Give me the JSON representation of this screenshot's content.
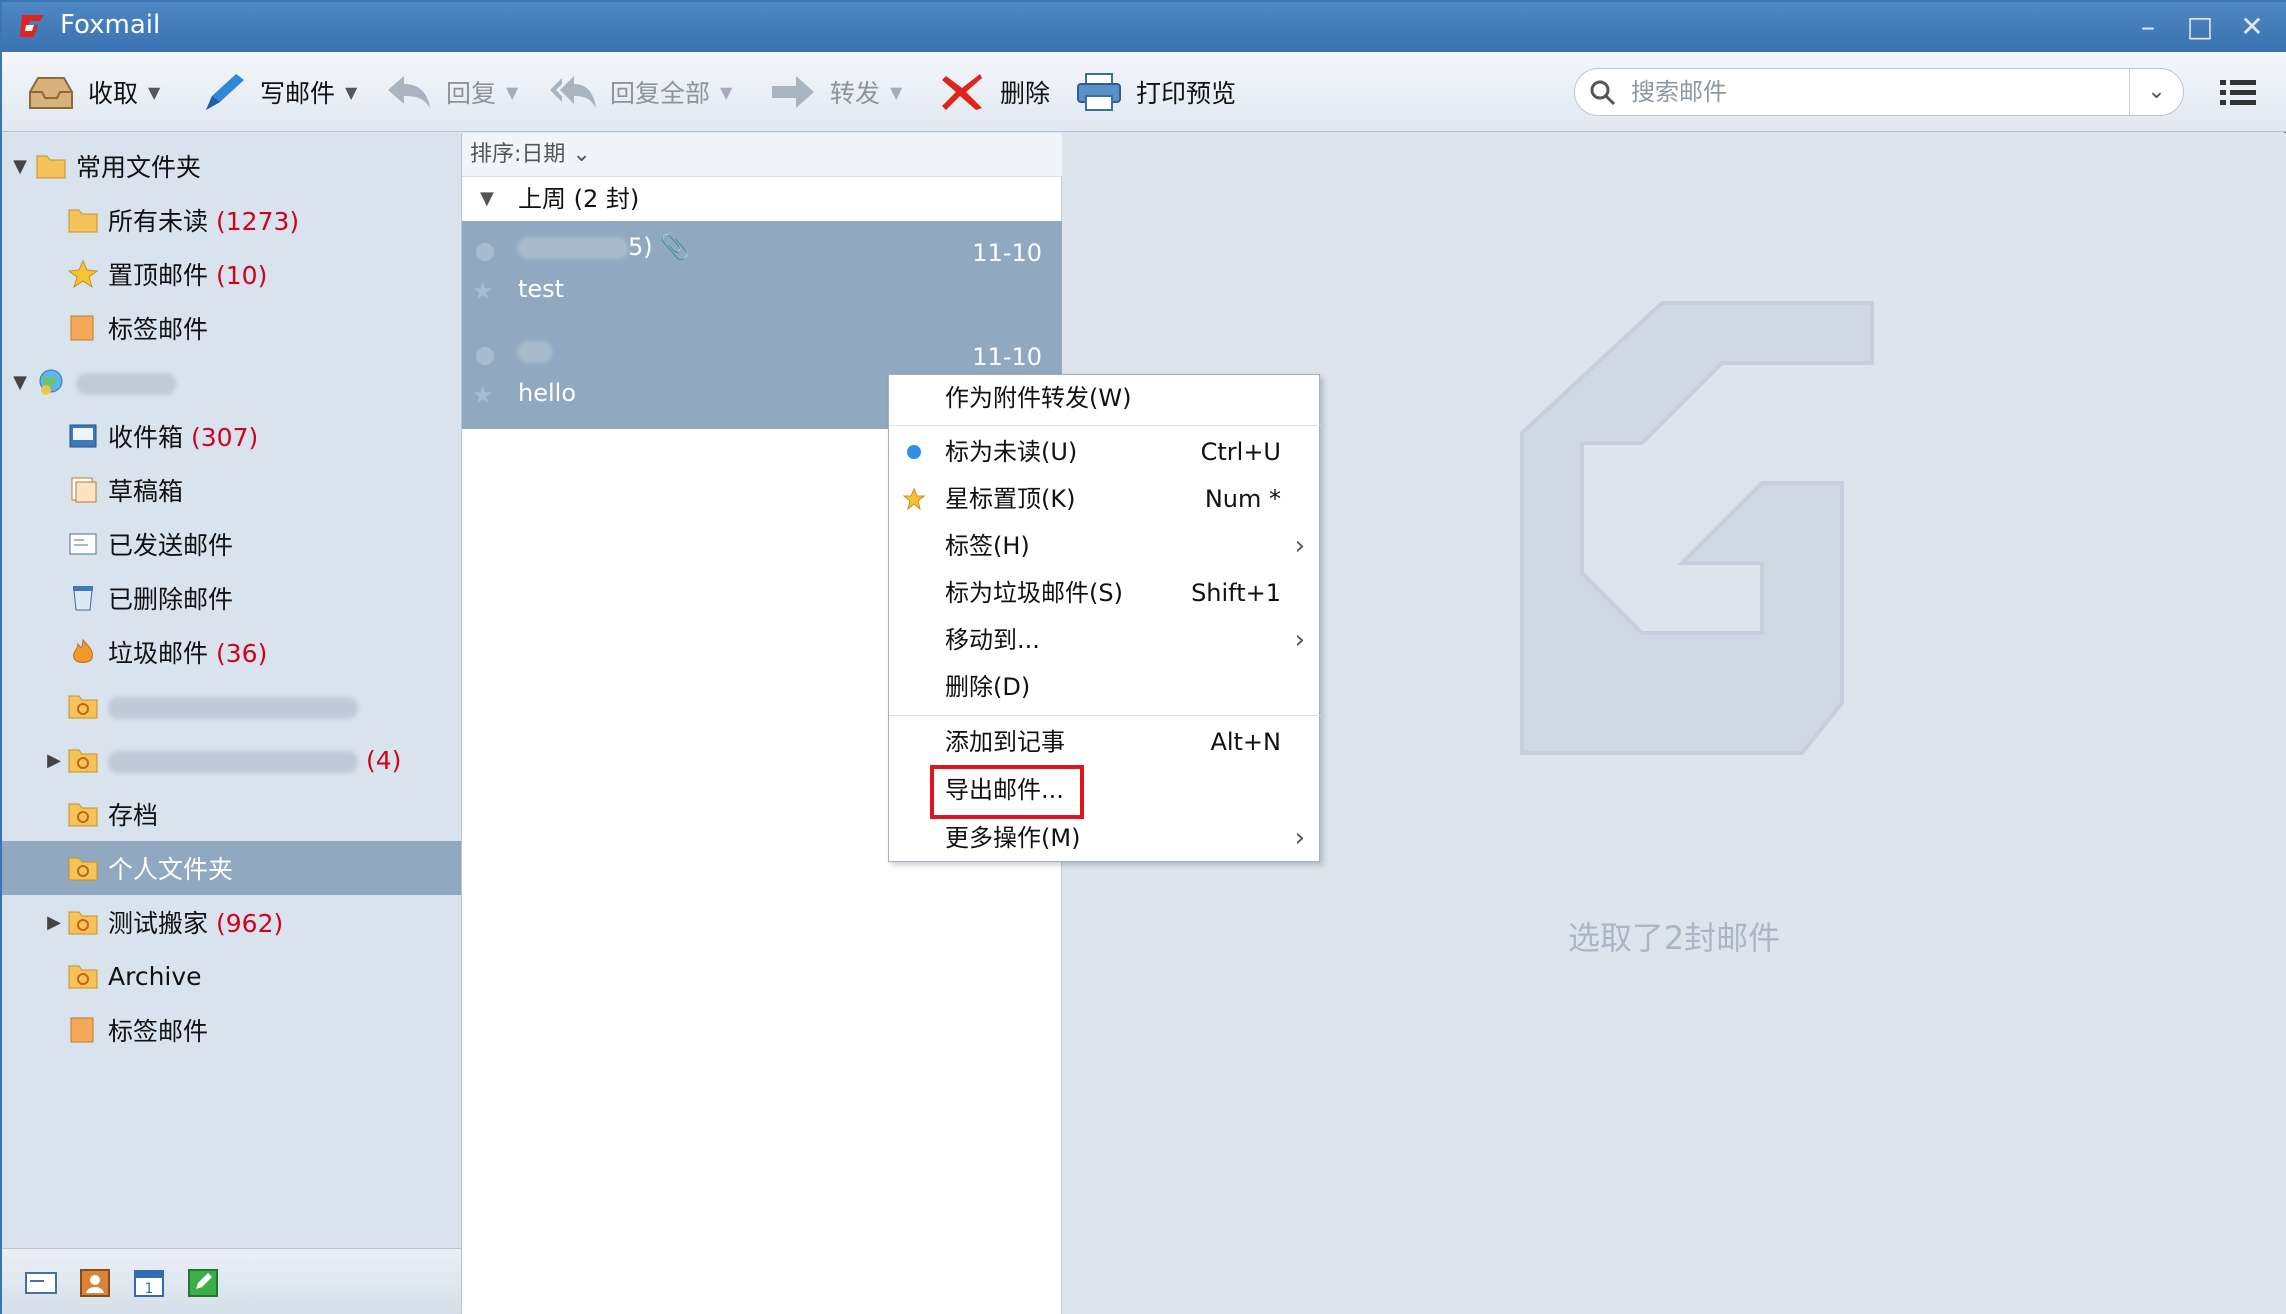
{
  "app": {
    "title": "Foxmail"
  },
  "toolbar": {
    "receive": "收取",
    "compose": "写邮件",
    "reply": "回复",
    "reply_all": "回复全部",
    "forward": "转发",
    "delete": "删除",
    "print_preview": "打印预览"
  },
  "search": {
    "placeholder": "搜索邮件"
  },
  "sidebar": {
    "common_group": "常用文件夹",
    "all_unread": {
      "label": "所有未读",
      "count": "(1273)"
    },
    "pinned": {
      "label": "置顶邮件",
      "count": "(10)"
    },
    "tagged": {
      "label": "标签邮件"
    },
    "inbox": {
      "label": "收件箱",
      "count": "(307)"
    },
    "drafts": {
      "label": "草稿箱"
    },
    "sent": {
      "label": "已发送邮件"
    },
    "deleted": {
      "label": "已删除邮件"
    },
    "spam": {
      "label": "垃圾邮件",
      "count": "(36)"
    },
    "imap2_count": "(4)",
    "archive_cn": {
      "label": "存档"
    },
    "personal": {
      "label": "个人文件夹"
    },
    "migrate": {
      "label": "测试搬家",
      "count": "(962)"
    },
    "archive_en": {
      "label": "Archive"
    },
    "tagged2": {
      "label": "标签邮件"
    }
  },
  "list": {
    "sort": "排序:日期",
    "group": "上周 (2 封)",
    "mails": [
      {
        "from_suffix": "5)",
        "date": "11-10",
        "subject": "test"
      },
      {
        "date": "11-10",
        "subject": "hello"
      }
    ]
  },
  "reading": {
    "status": "选取了2封邮件"
  },
  "context_menu": {
    "forward_attach": "作为附件转发(W)",
    "mark_unread": "标为未读(U)",
    "mark_unread_key": "Ctrl+U",
    "star_pin": "星标置顶(K)",
    "star_pin_key": "Num *",
    "tag": "标签(H)",
    "mark_spam": "标为垃圾邮件(S)",
    "mark_spam_key": "Shift+1",
    "move_to": "移动到...",
    "delete": "删除(D)",
    "add_note": "添加到记事",
    "add_note_key": "Alt+N",
    "export": "导出邮件...",
    "more": "更多操作(M)"
  },
  "colors": {
    "accent": "#3a72b1",
    "selected": "#90a9c1",
    "count": "#d0021b",
    "highlight": "#e0141e"
  }
}
